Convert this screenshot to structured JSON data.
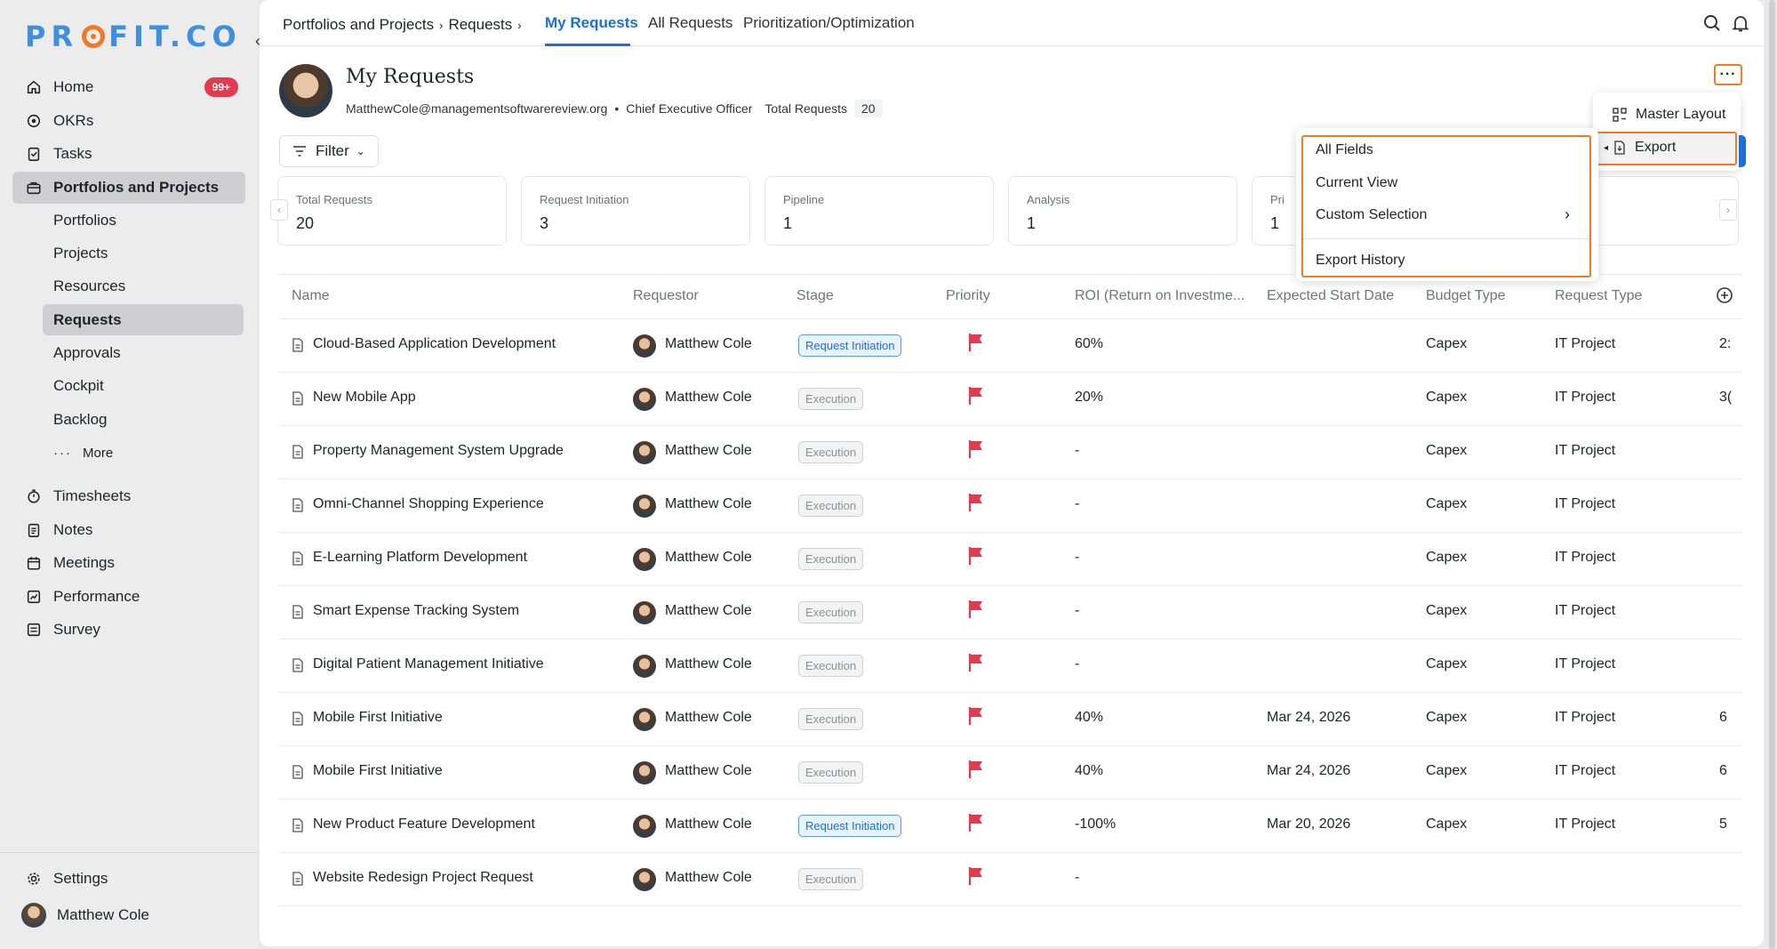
{
  "brand": {
    "logo_left": "PR",
    "logo_right": "FIT.CO"
  },
  "sidebar": {
    "home": {
      "label": "Home",
      "badge": "99+"
    },
    "items": [
      {
        "label": "OKRs"
      },
      {
        "label": "Tasks"
      },
      {
        "label": "Portfolios and Projects"
      }
    ],
    "sub_items": [
      {
        "label": "Portfolios"
      },
      {
        "label": "Projects"
      },
      {
        "label": "Resources"
      },
      {
        "label": "Requests"
      },
      {
        "label": "Approvals"
      },
      {
        "label": "Cockpit"
      },
      {
        "label": "Backlog"
      },
      {
        "label": "More"
      }
    ],
    "items2": [
      {
        "label": "Timesheets"
      },
      {
        "label": "Notes"
      },
      {
        "label": "Meetings"
      },
      {
        "label": "Performance"
      },
      {
        "label": "Survey"
      }
    ],
    "settings": "Settings",
    "user": "Matthew Cole"
  },
  "header": {
    "breadcrumb": [
      "Portfolios and Projects",
      "Requests"
    ],
    "tabs": [
      "My Requests",
      "All Requests",
      "Prioritization/Optimization"
    ]
  },
  "profile": {
    "name": "My Requests",
    "email": "MatthewCole@managementsoftwarereview.org",
    "role": "Chief Executive Officer",
    "total_label": "Total Requests",
    "total_value": "20"
  },
  "filter_label": "Filter",
  "cards": [
    {
      "label": "Total Requests",
      "value": "20"
    },
    {
      "label": "Request Initiation",
      "value": "3"
    },
    {
      "label": "Pipeline",
      "value": "1"
    },
    {
      "label": "Analysis",
      "value": "1"
    },
    {
      "label": "Pri",
      "value": "1"
    }
  ],
  "table": {
    "columns": [
      "Name",
      "Requestor",
      "Stage",
      "Priority",
      "ROI (Return on Investme...",
      "Expected Start Date",
      "Budget Type",
      "Request Type"
    ],
    "rows": [
      {
        "name": "Cloud-Based Application Development",
        "requestor": "Matthew Cole",
        "stage": "Request Initiation",
        "roi": "60%",
        "start": "",
        "budget": "Capex",
        "type": "IT Project",
        "extra": "2:"
      },
      {
        "name": "New Mobile App",
        "requestor": "Matthew Cole",
        "stage": "Execution",
        "roi": "20%",
        "start": "",
        "budget": "Capex",
        "type": "IT Project",
        "extra": "3("
      },
      {
        "name": "Property Management System Upgrade",
        "requestor": "Matthew Cole",
        "stage": "Execution",
        "roi": "-",
        "start": "",
        "budget": "Capex",
        "type": "IT Project",
        "extra": ""
      },
      {
        "name": "Omni-Channel Shopping Experience",
        "requestor": "Matthew Cole",
        "stage": "Execution",
        "roi": "-",
        "start": "",
        "budget": "Capex",
        "type": "IT Project",
        "extra": ""
      },
      {
        "name": "E-Learning Platform Development",
        "requestor": "Matthew Cole",
        "stage": "Execution",
        "roi": "-",
        "start": "",
        "budget": "Capex",
        "type": "IT Project",
        "extra": ""
      },
      {
        "name": "Smart Expense Tracking System",
        "requestor": "Matthew Cole",
        "stage": "Execution",
        "roi": "-",
        "start": "",
        "budget": "Capex",
        "type": "IT Project",
        "extra": ""
      },
      {
        "name": "Digital Patient Management Initiative",
        "requestor": "Matthew Cole",
        "stage": "Execution",
        "roi": "-",
        "start": "",
        "budget": "Capex",
        "type": "IT Project",
        "extra": ""
      },
      {
        "name": "Mobile First Initiative",
        "requestor": "Matthew Cole",
        "stage": "Execution",
        "roi": "40%",
        "start": "Mar 24, 2026",
        "budget": "Capex",
        "type": "IT Project",
        "extra": "6"
      },
      {
        "name": "Mobile First Initiative",
        "requestor": "Matthew Cole",
        "stage": "Execution",
        "roi": "40%",
        "start": "Mar 24, 2026",
        "budget": "Capex",
        "type": "IT Project",
        "extra": "6"
      },
      {
        "name": "New Product Feature Development",
        "requestor": "Matthew Cole",
        "stage": "Request Initiation",
        "roi": "-100%",
        "start": "Mar 20, 2026",
        "budget": "Capex",
        "type": "IT Project",
        "extra": "5"
      },
      {
        "name": "Website Redesign Project Request",
        "requestor": "Matthew Cole",
        "stage": "Execution",
        "roi": "-",
        "start": "",
        "budget": "",
        "type": "",
        "extra": ""
      }
    ]
  },
  "menu_more": {
    "master_layout": "Master Layout",
    "export": "Export"
  },
  "menu_export": {
    "all_fields": "All Fields",
    "current_view": "Current View",
    "custom_selection": "Custom Selection",
    "export_history": "Export History"
  },
  "colors": {
    "accent": "#1d6fd6",
    "highlight": "#f07a23",
    "flag": "#e23b4f",
    "badge": "#e23b4f"
  }
}
